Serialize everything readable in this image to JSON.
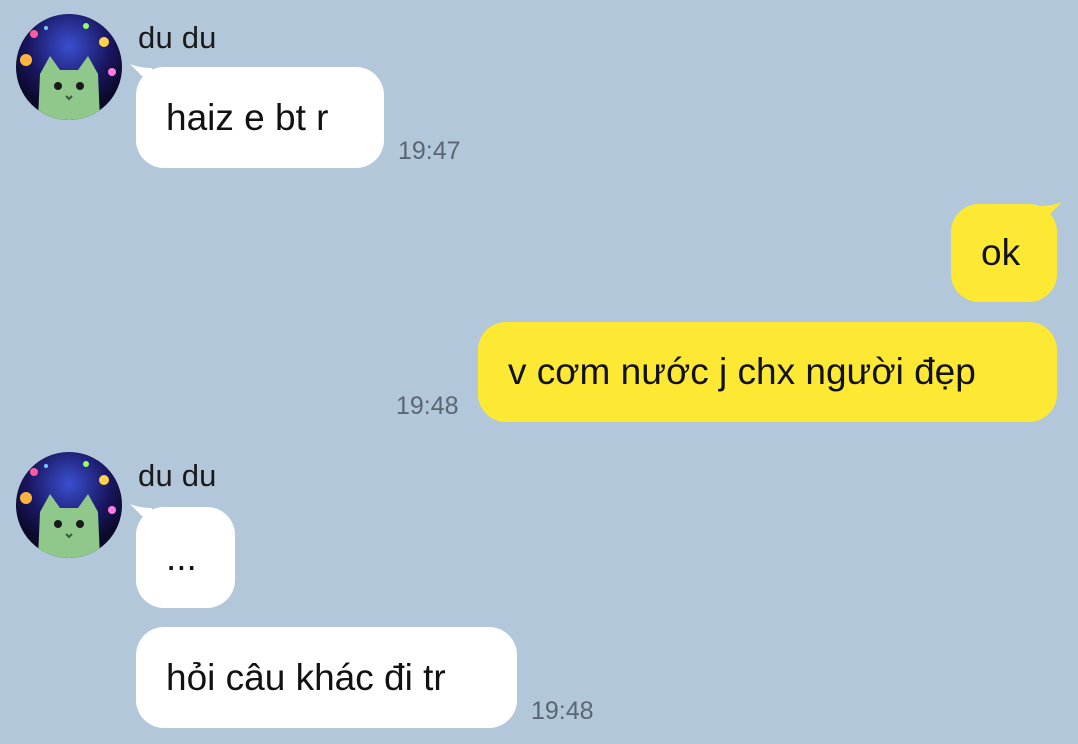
{
  "messages": [
    {
      "id": "m1",
      "direction": "incoming",
      "sender": "du du",
      "text": "haiz e bt r",
      "time": "19:47"
    },
    {
      "id": "m2",
      "direction": "outgoing",
      "text": "ok"
    },
    {
      "id": "m3",
      "direction": "outgoing",
      "text": "v cơm nước j chx người đẹp",
      "time": "19:48"
    },
    {
      "id": "m4",
      "direction": "incoming",
      "sender": "du du",
      "text": "..."
    },
    {
      "id": "m5",
      "direction": "incoming",
      "text": "hỏi câu khác đi tr",
      "time": "19:48"
    }
  ],
  "colors": {
    "background": "#b2c7da",
    "incoming_bubble": "#ffffff",
    "outgoing_bubble": "#fde933",
    "timestamp": "#5b6672"
  },
  "icons": {
    "avatar": "cat-avatar-icon"
  }
}
